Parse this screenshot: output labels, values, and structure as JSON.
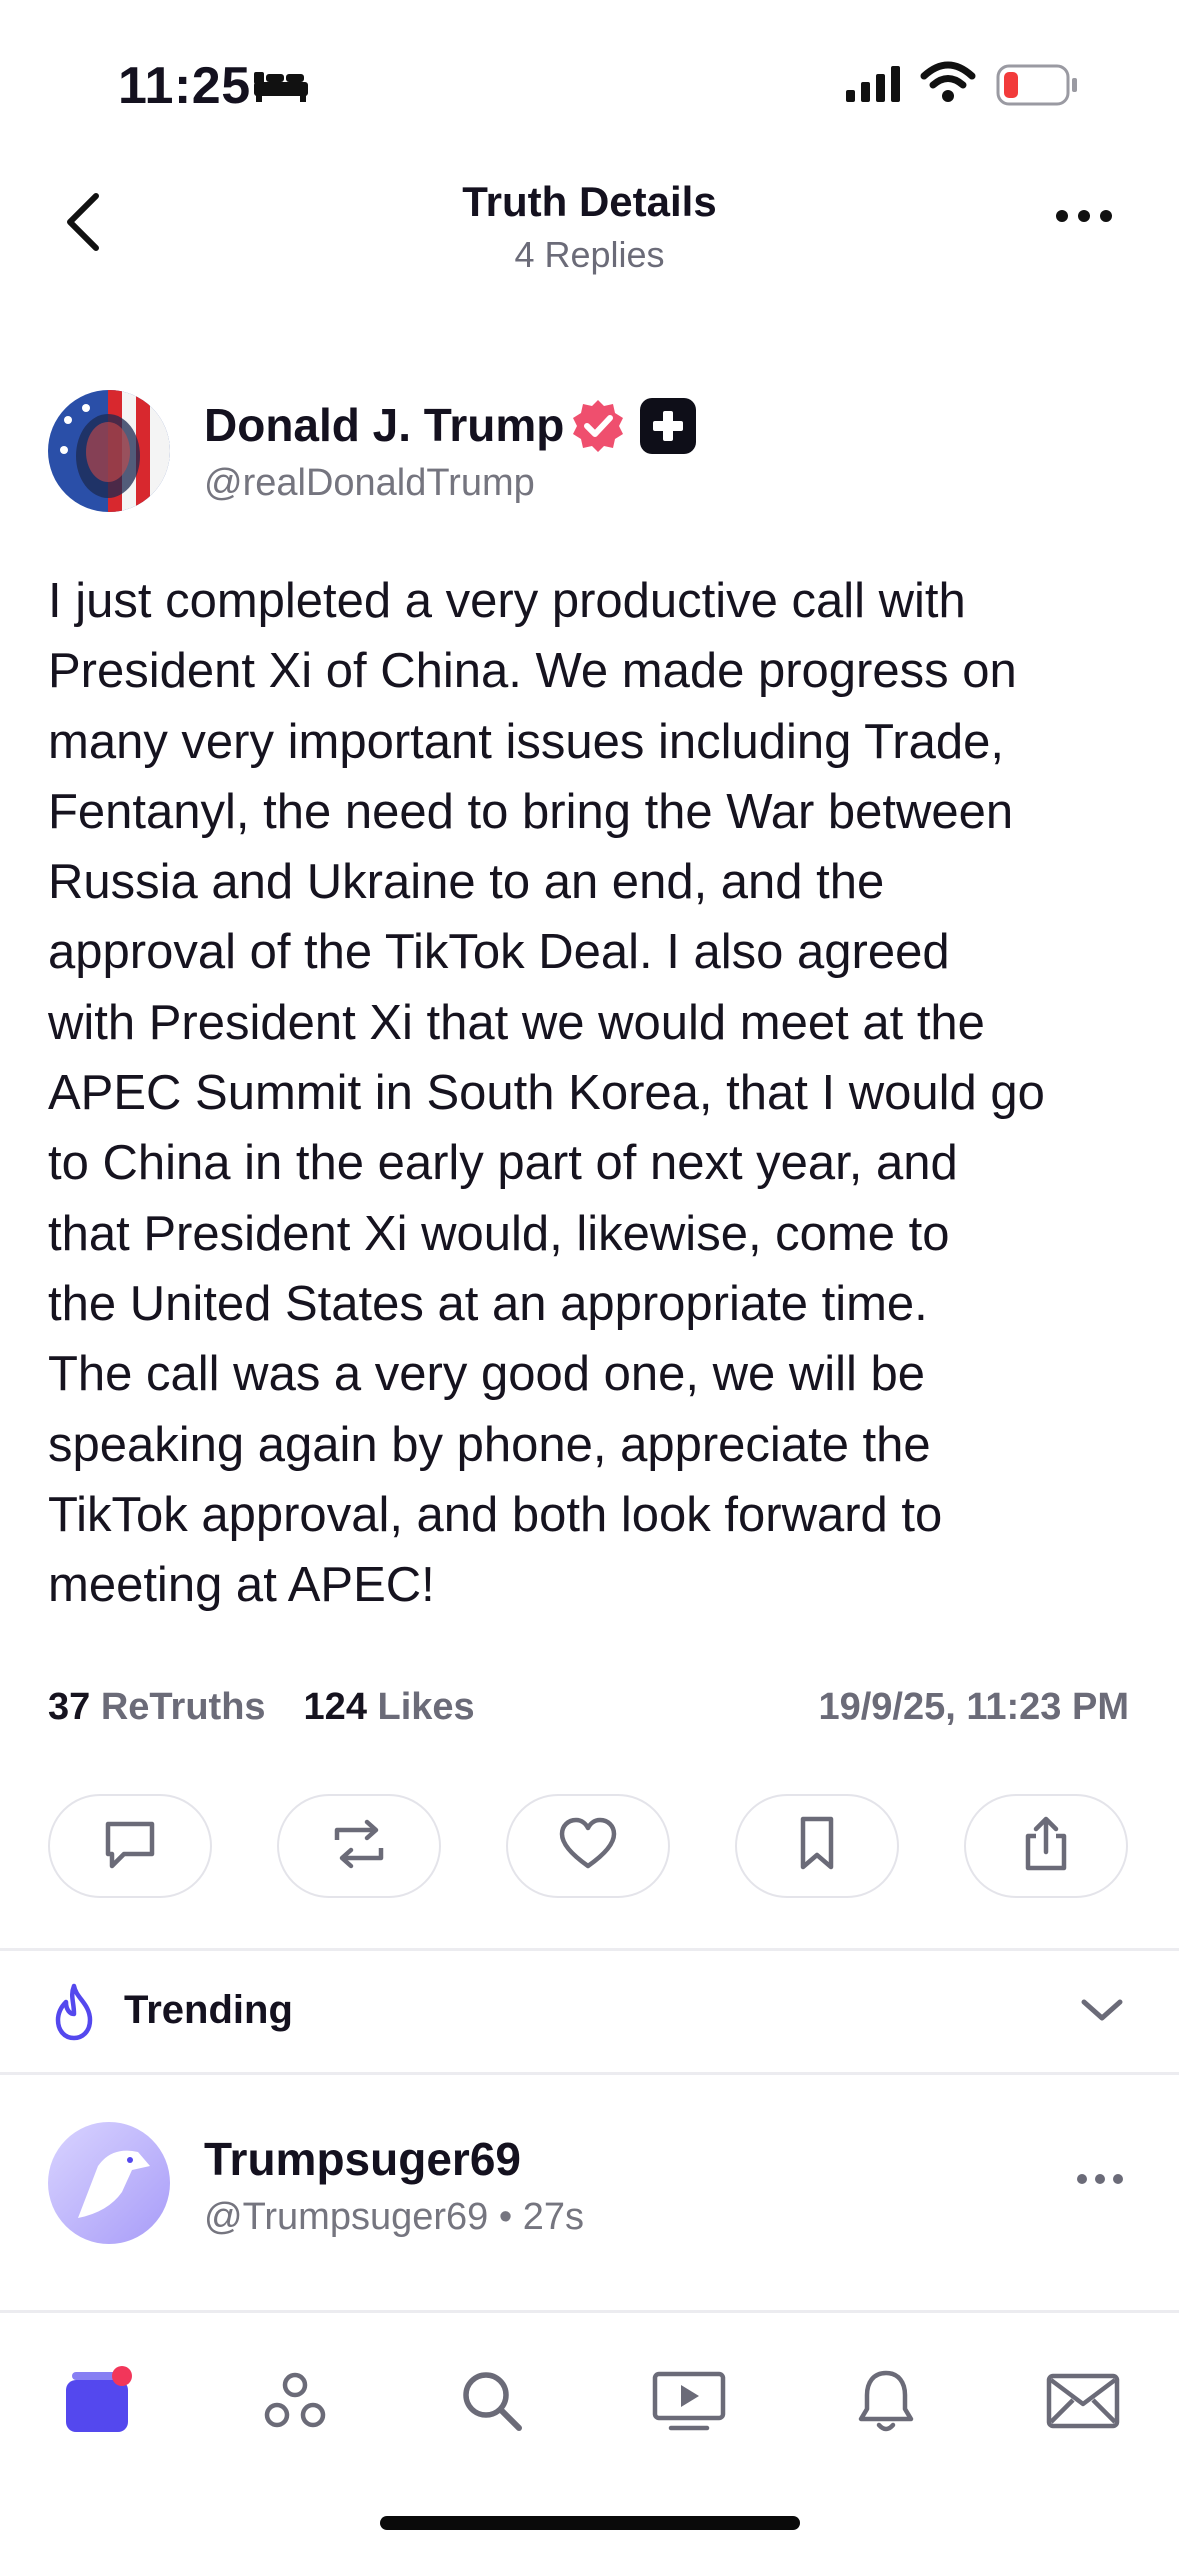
{
  "status_bar": {
    "time": "11:25"
  },
  "header": {
    "title": "Truth Details",
    "subtitle": "4 Replies"
  },
  "post": {
    "author_name": "Donald J. Trump",
    "author_handle": "@realDonaldTrump",
    "text": "I just completed a very productive call with\nPresident Xi of China. We made progress on\nmany very important issues including Trade,\nFentanyl, the need to bring the War between\nRussia and Ukraine to an end, and the\napproval of the TikTok Deal. I also agreed\nwith President Xi that we would meet at the\nAPEC Summit in South Korea, that I would go\nto China in the early part of next year, and\nthat President Xi would, likewise, come to\nthe United States at an appropriate time.\nThe call was a very good one, we will be\nspeaking again by phone, appreciate the\nTikTok approval, and both look forward to\nmeeting at APEC!",
    "retruths_count": "37",
    "retruths_label": "ReTruths",
    "likes_count": "124",
    "likes_label": "Likes",
    "timestamp": "19/9/25, 11:23 PM",
    "actions": [
      "reply-icon",
      "retruth-icon",
      "like-icon",
      "bookmark-icon",
      "share-icon"
    ]
  },
  "trending": {
    "label": "Trending"
  },
  "reply": {
    "author_name": "Trumpsuger69",
    "meta": "@Trumpsuger69 • 27s"
  },
  "tabbar": {
    "items": [
      "home-icon",
      "groups-icon",
      "search-icon",
      "tv-icon",
      "notifications-icon",
      "messages-icon"
    ],
    "accent": "#5448ee",
    "badge_color": "#f2365a"
  }
}
